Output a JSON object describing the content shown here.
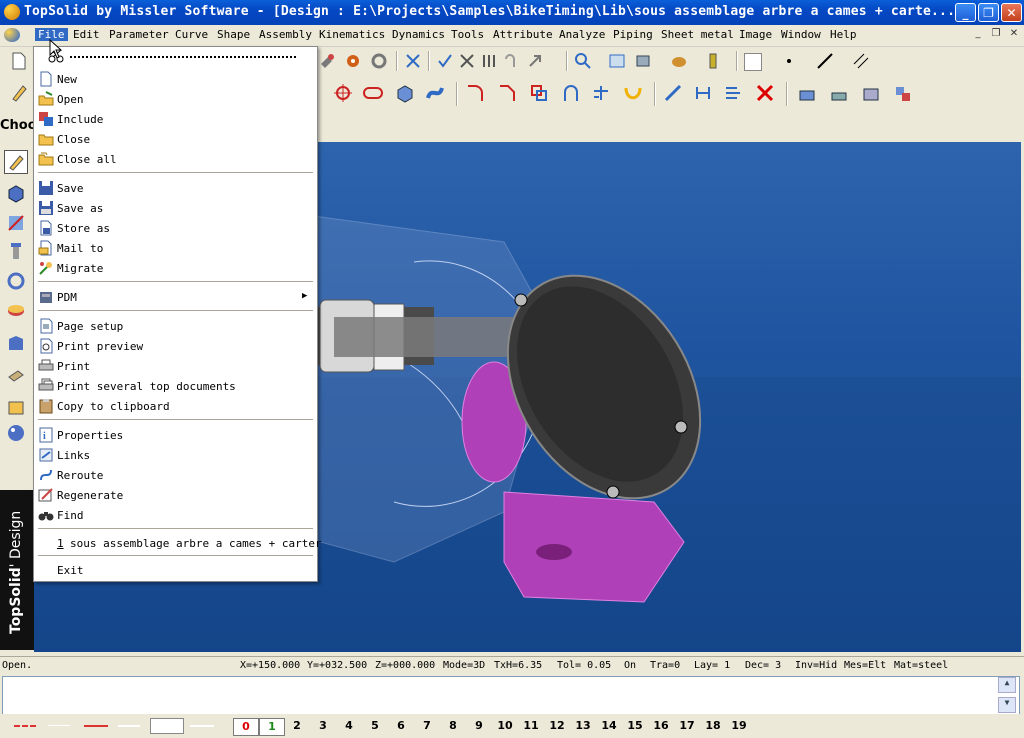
{
  "titlebar": {
    "title": "TopSolid by Missler Software - [Design : E:\\Projects\\Samples\\BikeTiming\\Lib\\sous assemblage arbre a cames + carte...",
    "minimize": "_",
    "maximize": "❐",
    "close": "✕"
  },
  "menubar": {
    "items": [
      "File",
      "Edit",
      "Parameter",
      "Curve",
      "Shape",
      "Assembly",
      "Kinematics",
      "Dynamics",
      "Tools",
      "Attribute",
      "Analyze",
      "Piping",
      "Sheet metal",
      "Image",
      "Window",
      "Help"
    ],
    "mdi_min": "_",
    "mdi_restore": "❐",
    "mdi_close": "✕"
  },
  "left_panel": {
    "choose_label": "Choo",
    "brand_bold": "TopSolid",
    "brand_light": "' Design"
  },
  "file_menu": {
    "items": [
      {
        "label": "New",
        "icon": "new-document-icon"
      },
      {
        "label": "Open",
        "icon": "open-folder-icon"
      },
      {
        "label": "Include",
        "icon": "include-icon"
      },
      {
        "label": "Close",
        "icon": "close-folder-icon"
      },
      {
        "label": "Close all",
        "icon": "close-all-icon"
      },
      {
        "label": "Save",
        "icon": "save-icon"
      },
      {
        "label": "Save as",
        "icon": "save-as-icon"
      },
      {
        "label": "Store as",
        "icon": "store-as-icon"
      },
      {
        "label": "Mail to",
        "icon": "mail-icon"
      },
      {
        "label": "Migrate",
        "icon": "migrate-icon"
      },
      {
        "label": "PDM",
        "icon": "pdm-icon"
      },
      {
        "label": "Page setup",
        "icon": "page-setup-icon"
      },
      {
        "label": "Print preview",
        "icon": "print-preview-icon"
      },
      {
        "label": "Print",
        "icon": "print-icon"
      },
      {
        "label": "Print several top documents",
        "icon": "print-several-icon"
      },
      {
        "label": "Copy to clipboard",
        "icon": "clipboard-icon"
      },
      {
        "label": "Properties",
        "icon": "properties-icon"
      },
      {
        "label": "Links",
        "icon": "links-icon"
      },
      {
        "label": "Reroute",
        "icon": "reroute-icon"
      },
      {
        "label": "Regenerate",
        "icon": "regenerate-icon"
      },
      {
        "label": "Find",
        "icon": "find-icon"
      }
    ],
    "recent_num": "1",
    "recent_label": "sous assemblage arbre a cames + carter",
    "exit": "Exit",
    "submenu_arrow": "▶"
  },
  "statusbar": {
    "status": "Open.",
    "x": "X=+150.000",
    "y": "Y=+032.500",
    "z": "Z=+000.000",
    "mode": "Mode=3D",
    "txh": "TxH=6.35",
    "tol": "Tol=  0.05",
    "on": "On",
    "tra": "Tra=0",
    "lay": "Lay=  1",
    "dec": "Dec= 3",
    "inv": "Inv=Hid",
    "mes": "Mes=Elt",
    "mat": "Mat=steel"
  },
  "bottombar": {
    "layers": [
      "0",
      "1",
      "2",
      "3",
      "4",
      "5",
      "6",
      "7",
      "8",
      "9",
      "10",
      "11",
      "12",
      "13",
      "14",
      "15",
      "16",
      "17",
      "18",
      "19"
    ]
  },
  "colors": {
    "menu_highlight": "#316ac5",
    "viewport_blue": "#1f55a0",
    "part_magenta": "#c040c0",
    "cover_dark": "#3a3a3a"
  }
}
